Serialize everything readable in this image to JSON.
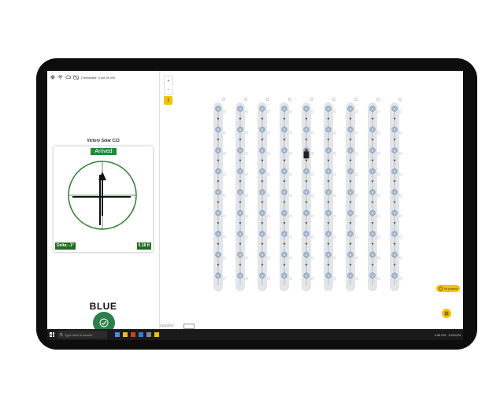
{
  "status_bar": {
    "completed_text": "Completed: 3 out of 108"
  },
  "site": {
    "name": "Victory Solar C13"
  },
  "compass": {
    "status": "Arrived",
    "delta": "Delta: -1°",
    "distance": "0.18 ft"
  },
  "marker": {
    "color_word": "BLUE"
  },
  "map": {
    "zoom_in": "+",
    "zoom_out": "−",
    "info_label": "i",
    "placed_label": "0x placed",
    "rows": 9,
    "points_per_row": 9,
    "point_label": "B",
    "footer_logo": "mapbox"
  },
  "taskbar": {
    "search_placeholder": "Type here to search",
    "time": "4:55 PM",
    "date": "1/2/2023"
  },
  "colors": {
    "accent": "#f2c200",
    "arrived_green": "#1f8a3a",
    "compass_green": "#2e7d2e",
    "confirm_green": "#2e7d4a",
    "point_blue": "#9fb4cc"
  }
}
